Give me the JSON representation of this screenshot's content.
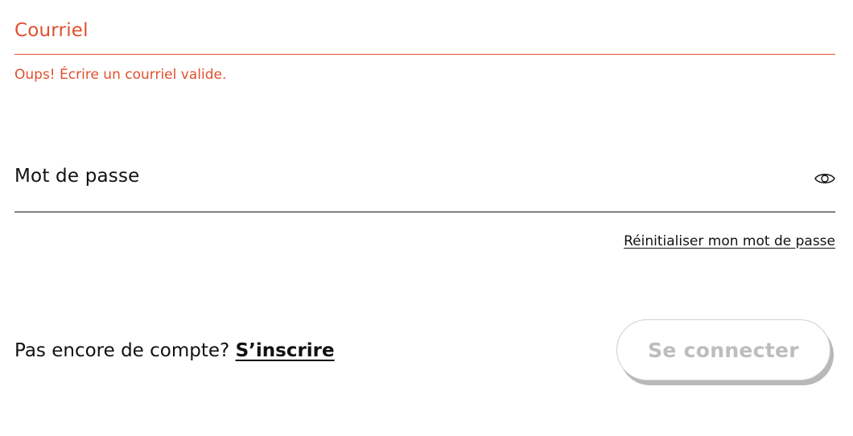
{
  "email": {
    "label": "Courriel",
    "error": "Oups! Écrire un courriel valide."
  },
  "password": {
    "label": "Mot de passe",
    "toggle_icon": "eye-icon",
    "reset_link": "Réinitialiser mon mot de passe"
  },
  "signup": {
    "prompt": "Pas encore de compte?",
    "link": "S’inscrire"
  },
  "submit": {
    "label": "Se connecter",
    "state": "disabled"
  },
  "colors": {
    "error": "#e0502f",
    "text": "#111111",
    "disabled_text": "#bdbdbd",
    "button_shadow": "#b8b8b8"
  }
}
